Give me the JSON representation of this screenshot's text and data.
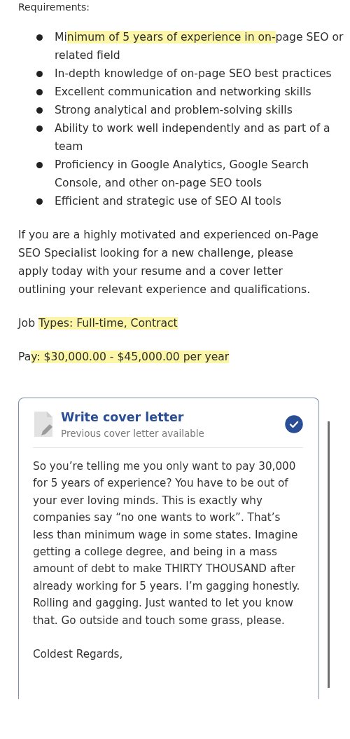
{
  "requirements_heading": "Requirements:",
  "requirements": [
    [
      {
        "text": "Mi",
        "highlighted": false
      },
      {
        "text": "nimum of 5 years of experience in on-",
        "highlighted": true
      },
      {
        "text": "page SEO or related field",
        "highlighted": false
      }
    ],
    [
      {
        "text": "In-depth knowledge of on-page SEO best practices",
        "highlighted": false
      }
    ],
    [
      {
        "text": "Excellent communication and networking skills",
        "highlighted": false
      }
    ],
    [
      {
        "text": "Strong analytical and problem-solving skills",
        "highlighted": false
      }
    ],
    [
      {
        "text": "Ability to work well independently and as part of a team",
        "highlighted": false
      }
    ],
    [
      {
        "text": "Proficiency in Google Analytics, Google Search Console, and other on-page SEO tools",
        "highlighted": false
      }
    ],
    [
      {
        "text": "Efficient and strategic use of SEO AI tools",
        "highlighted": false
      }
    ]
  ],
  "closing": "If you are a highly motivated and experienced on-Page SEO Specialist looking for a new challenge, please apply today with your resume and a cover letter outlining your relevant experience and qualifications.",
  "job_types": [
    {
      "text": "Job ",
      "highlighted": false
    },
    {
      "text": "Types: Full-time, Contract",
      "highlighted": true
    }
  ],
  "pay": [
    {
      "text": "Pa",
      "highlighted": false
    },
    {
      "text": "y: $30,000.00 - $45,000.00 per year",
      "highlighted": true
    }
  ],
  "cover_letter": {
    "title": "Write cover letter",
    "subtitle": "Previous cover letter available",
    "selected": true,
    "value": "So you’re telling me you only want to pay 30,000 for 5 years of experience? You have to be out of your ever loving minds. This is exactly why companies say “no one wants to work”. That’s less than minimum wage in some states. Imagine getting a college degree, and being in a mass amount of debt to make THIRTY THOUSAND after already working for 5 years. I’m gagging honestly. Rolling and gagging. Just wanted to let you know that. Go outside and touch some grass, please.\n\nColdest Regards,"
  }
}
